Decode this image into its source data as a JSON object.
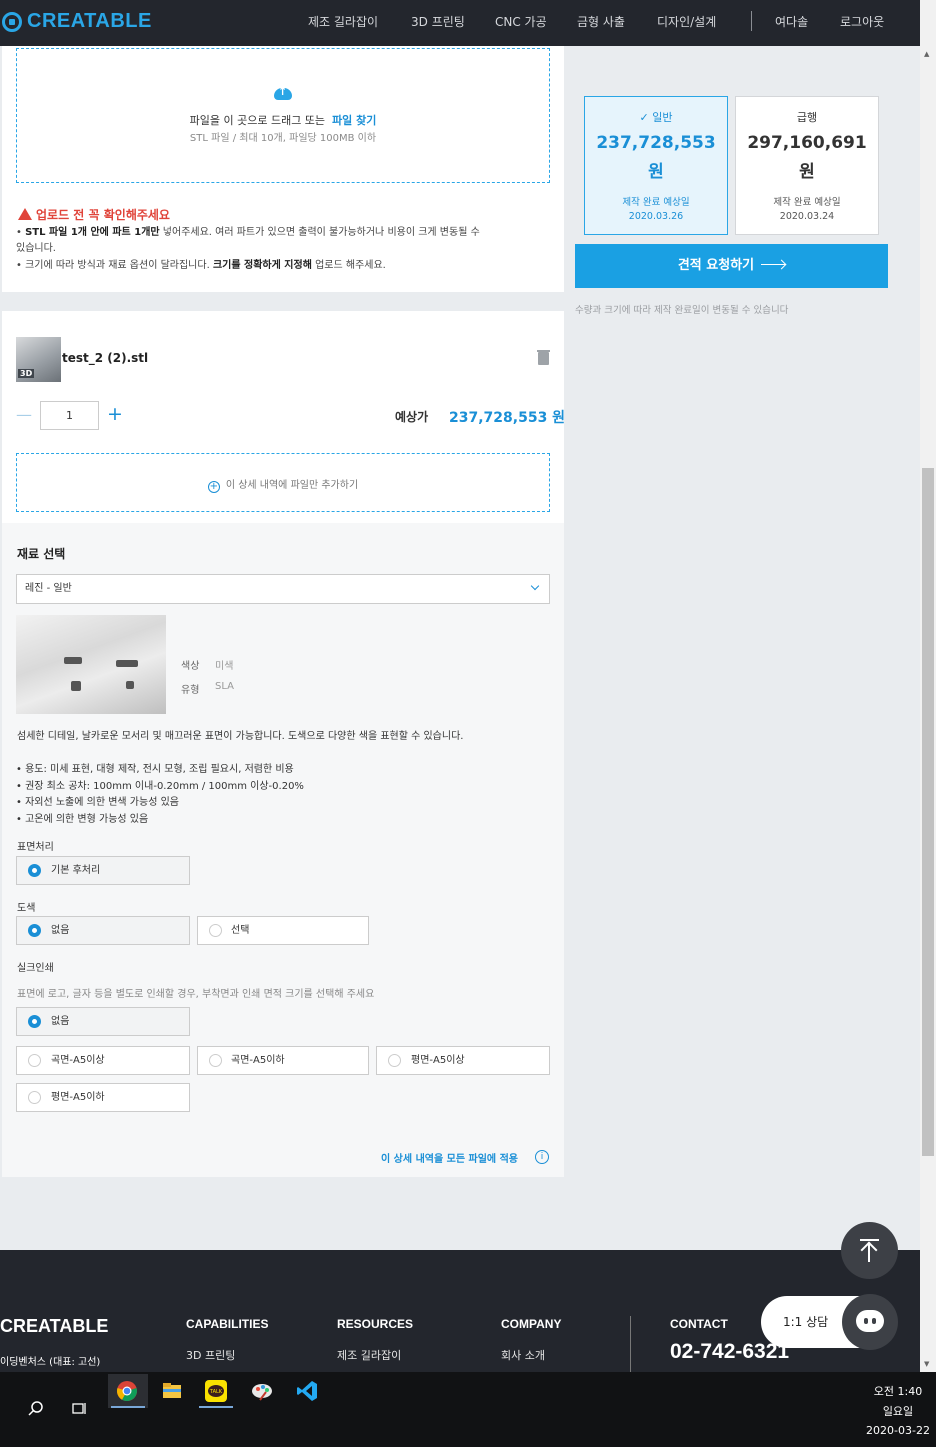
{
  "header": {
    "logo": "CREATABLE",
    "nav": [
      {
        "label": "제조 길라잡이"
      },
      {
        "label": "3D 프린팅"
      },
      {
        "label": "CNC 가공"
      },
      {
        "label": "금형 사출"
      },
      {
        "label": "디자인/설계"
      },
      {
        "label": "여다솔"
      },
      {
        "label": "로그아웃"
      }
    ]
  },
  "upload": {
    "drop_text": "파일을 이 곳으로 드래그 또는",
    "find_link": "파일 찾기",
    "limits": "STL 파일 / 최대 10개, 파일당 100MB 이하",
    "warning_title": "업로드 전 꼭 확인해주세요",
    "warning_1_prefix": "• ",
    "warning_1_bold": "STL 파일 1개 안에 파트 1개만",
    "warning_1_rest": " 넣어주세요. 여러 파트가 있으면 출력이 불가능하거나 비용이 크게 변동될 수",
    "warning_1_cont": "있습니다.",
    "warning_2_prefix": "• 크기에 따라 방식과 재료 옵션이 달라집니다. ",
    "warning_2_bold": "크기를 정확하게 지정해",
    "warning_2_rest": " 업로드 해주세요."
  },
  "file": {
    "thumb_tag": "3D",
    "name": "test_2 (2).stl",
    "quantity": "1",
    "price_label": "예상가",
    "price_value": "237,728,553 원",
    "add_file": "이 상세 내역에 파일만 추가하기"
  },
  "material": {
    "title": "재료 선택",
    "selected": "레진 - 일반",
    "props": [
      {
        "key": "색상",
        "value": "미색"
      },
      {
        "key": "유형",
        "value": "SLA"
      }
    ],
    "description": "섬세한 디테일, 날카로운 모서리 및 매끄러운 표면이 가능합니다. 도색으로 다양한 색을 표현할 수 있습니다.",
    "bullets": [
      "• 용도: 미세 표현, 대형 제작, 전시 모형, 조립 필요시, 저렴한 비용",
      "• 권장 최소 공차: 100mm 이내-0.20mm / 100mm 이상-0.20%",
      "• 자외선 노출에 의한 변색 가능성 있음",
      "• 고온에 의한 변형 가능성 있음"
    ]
  },
  "options": {
    "surface": {
      "label": "표면처리",
      "choices": [
        "기본 후처리"
      ]
    },
    "paint": {
      "label": "도색",
      "choices": [
        "없음",
        "선택"
      ]
    },
    "silk": {
      "label": "실크인쇄",
      "sub": "표면에 로고, 글자 등을 별도로 인쇄할 경우, 부착면과 인쇄 면적 크기를 선택해 주세요",
      "choices": [
        "없음",
        "곡면-A5이상",
        "곡면-A5이하",
        "평면-A5이상",
        "평면-A5이하"
      ]
    },
    "apply_all": "이 상세 내역을 모든 파일에 적용"
  },
  "estimate": {
    "normal": {
      "name": "일반",
      "price_line1": "237,728,553",
      "price_line2": "원",
      "sub": "제작 완료 예상일",
      "date": "2020.03.26"
    },
    "express": {
      "name": "급행",
      "price_line1": "297,160,691",
      "price_line2": "원",
      "sub": "제작 완료 예상일",
      "date": "2020.03.24"
    },
    "button": "견적 요청하기",
    "note": "수량과 크기에 따라 제작 완료일이 변동될 수 있습니다"
  },
  "footer": {
    "logo": "CREATABLE",
    "company": "이딩벤처스 (대표: 고선)",
    "cols": [
      {
        "heading": "CAPABILITIES",
        "link": "3D 프린팅"
      },
      {
        "heading": "RESOURCES",
        "link": "제조 길라잡이"
      },
      {
        "heading": "COMPANY",
        "link": "회사 소개"
      },
      {
        "heading": "CONTACT",
        "link": "02-742-6321"
      }
    ]
  },
  "widgets": {
    "chat_label": "1:1 상담"
  },
  "taskbar": {
    "time": "오전 1:40",
    "day": "일요일",
    "date": "2020-03-22"
  },
  "colors": {
    "accent": "#1a8fd6",
    "header_bg": "#23262d",
    "warning": "#e0443a"
  }
}
